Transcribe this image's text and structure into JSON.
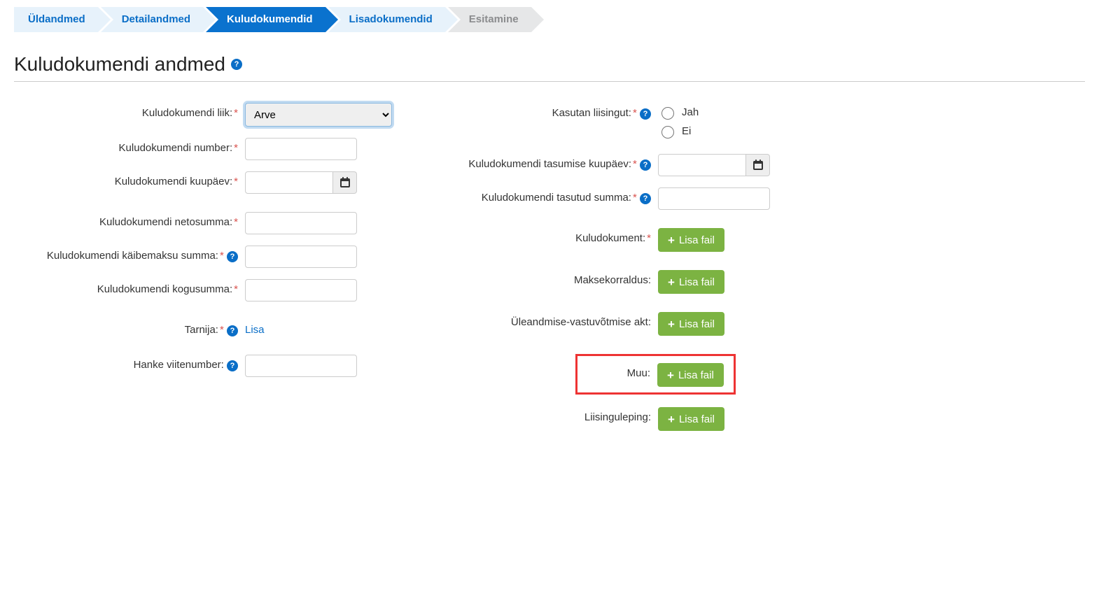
{
  "wizard": [
    {
      "label": "Üldandmed",
      "state": "normal"
    },
    {
      "label": "Detailandmed",
      "state": "normal"
    },
    {
      "label": "Kuludokumendid",
      "state": "active"
    },
    {
      "label": "Lisadokumendid",
      "state": "normal"
    },
    {
      "label": "Esitamine",
      "state": "disabled"
    }
  ],
  "heading": "Kuludokumendi andmed",
  "left": {
    "type_label": "Kuludokumendi liik:",
    "type_value": "Arve",
    "number_label": "Kuludokumendi number:",
    "date_label": "Kuludokumendi kuupäev:",
    "net_label": "Kuludokumendi netosumma:",
    "vat_label": "Kuludokumendi käibemaksu summa:",
    "total_label": "Kuludokumendi kogusumma:",
    "supplier_label": "Tarnija:",
    "supplier_link": "Lisa",
    "procurement_label": "Hanke viitenumber:"
  },
  "right": {
    "leasing_label": "Kasutan liisingut:",
    "leasing_yes": "Jah",
    "leasing_no": "Ei",
    "paid_date_label": "Kuludokumendi tasumise kuupäev:",
    "paid_sum_label": "Kuludokumendi tasutud summa:",
    "cost_doc_label": "Kuludokument:",
    "payment_order_label": "Maksekorraldus:",
    "handover_label": "Üleandmise-vastuvõtmise akt:",
    "other_label": "Muu:",
    "leasing_contract_label": "Liisinguleping:",
    "add_file": "Lisa fail"
  }
}
